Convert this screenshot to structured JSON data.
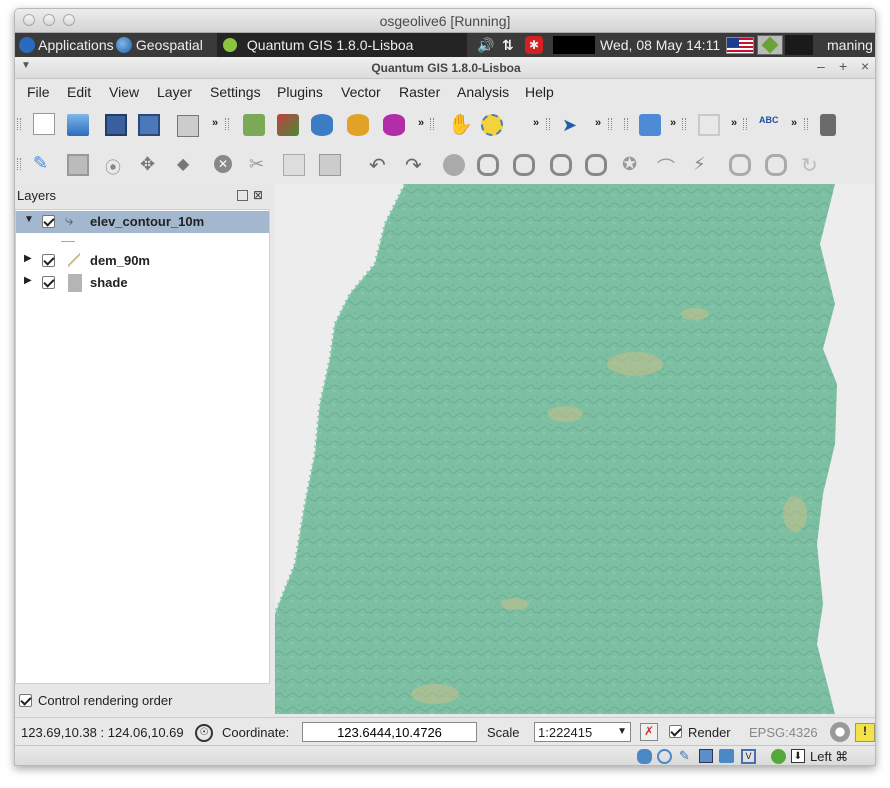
{
  "vm": {
    "title": "osgeolive6 [Running]"
  },
  "panel": {
    "applications": "Applications",
    "geospatial": "Geospatial",
    "task": "Quantum GIS 1.8.0-Lisboa",
    "clock": "Wed, 08 May  14:11",
    "user": "maning"
  },
  "qgis": {
    "title": "Quantum GIS 1.8.0-Lisboa",
    "menu": [
      "File",
      "Edit",
      "View",
      "Layer",
      "Settings",
      "Plugins",
      "Vector",
      "Raster",
      "Analysis",
      "Help"
    ],
    "overflow": "»"
  },
  "layers_panel": {
    "title": "Layers",
    "layers": [
      {
        "name": "elev_contour_10m",
        "checked": true,
        "expanded": true,
        "selected": true
      },
      {
        "name": "dem_90m",
        "checked": true,
        "expanded": false
      },
      {
        "name": "shade",
        "checked": true,
        "expanded": false
      }
    ],
    "control_rendering": "Control rendering order"
  },
  "status": {
    "extent": "123.69,10.38 : 124.06,10.69",
    "coordinate_label": "Coordinate:",
    "coordinate_value": "123.6444,10.4726",
    "scale_label": "Scale",
    "scale_value": "1:222415",
    "render_label": "Render",
    "crs": "EPSG:4326"
  },
  "tray": {
    "host_key": "Left ⌘"
  },
  "colors": {
    "map_fill": "#7cbfa3",
    "map_bg": "#ededed",
    "selection": "#a3b7cf"
  }
}
